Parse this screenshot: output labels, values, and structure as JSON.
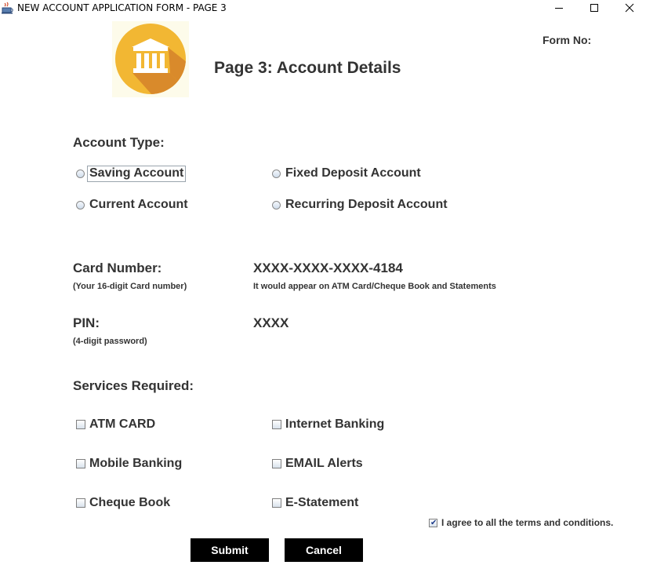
{
  "window": {
    "title": "NEW ACCOUNT APPLICATION FORM - PAGE 3",
    "app_icon": "java-cup-icon",
    "controls": [
      "minimize-icon",
      "maximize-icon",
      "close-icon"
    ]
  },
  "header": {
    "logo_icon": "bank-building-icon",
    "heading": "Page 3: Account Details",
    "form_no_label": "Form No:"
  },
  "account_type": {
    "label": "Account Type:",
    "options": [
      {
        "label": "Saving Account",
        "selected": false,
        "focused": true
      },
      {
        "label": "Fixed Deposit Account",
        "selected": false
      },
      {
        "label": "Current Account",
        "selected": false
      },
      {
        "label": "Recurring Deposit Account",
        "selected": false
      }
    ]
  },
  "card": {
    "label": "Card Number:",
    "hint": "(Your 16-digit Card number)",
    "value": "XXXX-XXXX-XXXX-4184",
    "note": "It would appear on ATM Card/Cheque Book and Statements"
  },
  "pin": {
    "label": "PIN:",
    "hint": "(4-digit password)",
    "value": "XXXX"
  },
  "services": {
    "label": "Services Required:",
    "options": [
      {
        "label": "ATM CARD",
        "checked": false
      },
      {
        "label": "Internet Banking",
        "checked": false
      },
      {
        "label": "Mobile Banking",
        "checked": false
      },
      {
        "label": "EMAIL Alerts",
        "checked": false
      },
      {
        "label": "Cheque Book",
        "checked": false
      },
      {
        "label": "E-Statement",
        "checked": false
      }
    ]
  },
  "agreement": {
    "label": "I agree to all the terms and conditions.",
    "checked": true
  },
  "buttons": {
    "submit": "Submit",
    "cancel": "Cancel"
  },
  "colors": {
    "logo_circle": "#f2b733",
    "logo_shadow": "#d98a2b",
    "text": "#333333",
    "button_bg": "#000000",
    "button_text": "#ffffff"
  }
}
